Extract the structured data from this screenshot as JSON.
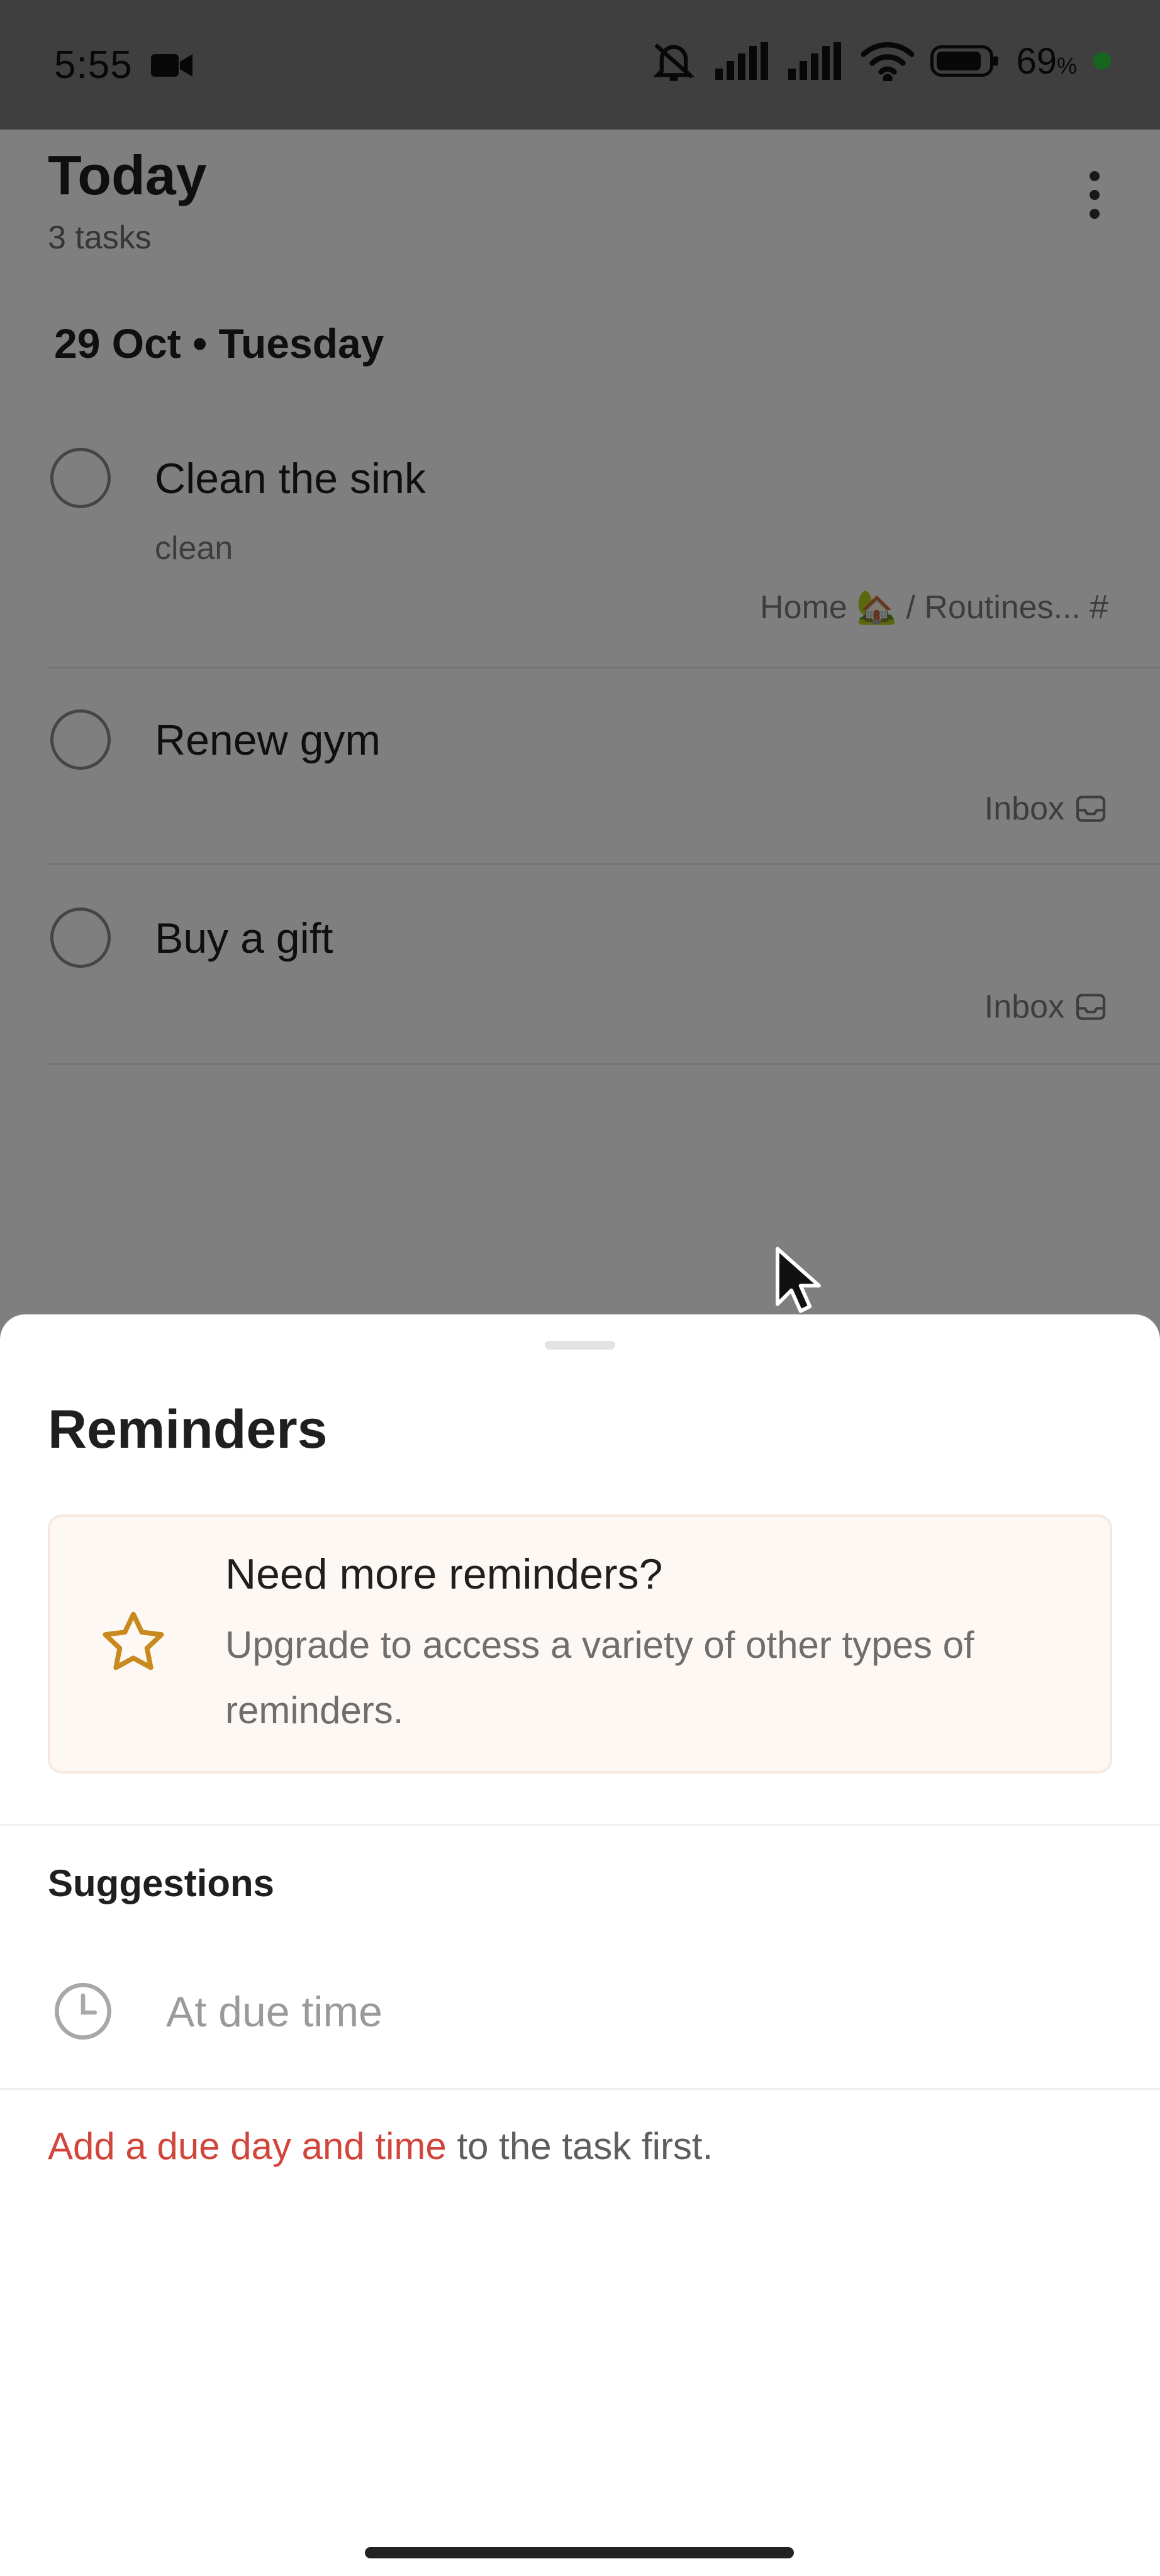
{
  "status_bar": {
    "time": "5:55",
    "battery_percent": "69",
    "battery_unit": "%",
    "icons": [
      "video-camera-icon",
      "bell-muted-icon",
      "signal-icon",
      "signal-icon",
      "wifi-icon",
      "battery-icon"
    ]
  },
  "header": {
    "title": "Today",
    "subtitle": "3 tasks"
  },
  "date_header": "29 Oct • Tuesday",
  "tasks": [
    {
      "title": "Clean the sink",
      "description": "clean",
      "project": "Home 🏡 / Routines...",
      "project_icon": "hashtag-icon"
    },
    {
      "title": "Renew gym",
      "description": "",
      "project": "Inbox",
      "project_icon": "inbox-icon"
    },
    {
      "title": "Buy a gift",
      "description": "",
      "project": "Inbox",
      "project_icon": "inbox-icon"
    }
  ],
  "sheet": {
    "title": "Reminders",
    "upgrade": {
      "heading": "Need more reminders?",
      "body": "Upgrade to access a variety of other types of reminders.",
      "accent_color": "#c8891e"
    },
    "section_title": "Suggestions",
    "suggestion": "At due time",
    "hint_link": "Add a due day and time",
    "hint_rest": " to the task first.",
    "link_color": "#d1453b"
  }
}
